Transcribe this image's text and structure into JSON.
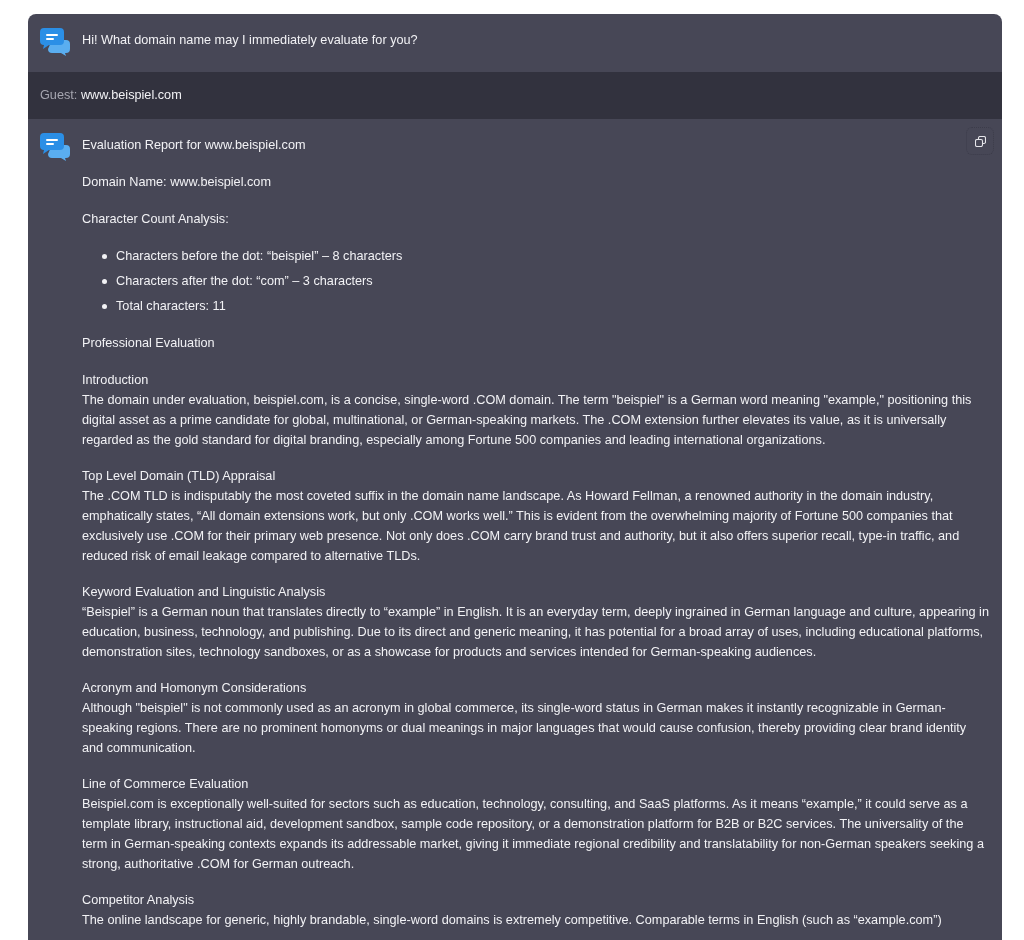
{
  "messages": [
    {
      "kind": "bot",
      "blocks": [
        {
          "kind": "paragraph",
          "text": "Hi! What domain name may I immediately evaluate for you?"
        }
      ]
    },
    {
      "kind": "guest",
      "label": "Guest:",
      "text": "www.beispiel.com"
    },
    {
      "kind": "bot",
      "copy_button": true,
      "blocks": [
        {
          "kind": "paragraph",
          "text": "Evaluation Report for www.beispiel.com"
        },
        {
          "kind": "paragraph",
          "text": "Domain Name: www.beispiel.com"
        },
        {
          "kind": "paragraph",
          "text": "Character Count Analysis:"
        },
        {
          "kind": "list",
          "items": [
            "Characters before the dot: “beispiel” – 8 characters",
            "Characters after the dot: “com” – 3 characters",
            "Total characters: 11"
          ]
        },
        {
          "kind": "paragraph",
          "text": "Professional Evaluation"
        },
        {
          "kind": "section",
          "heading": "Introduction",
          "text": "The domain under evaluation, beispiel.com, is a concise, single-word .COM domain. The term \"beispiel\" is a German word meaning \"example,\" positioning this digital asset as a prime candidate for global, multinational, or German-speaking markets. The .COM extension further elevates its value, as it is universally regarded as the gold standard for digital branding, especially among Fortune 500 companies and leading international organizations."
        },
        {
          "kind": "section",
          "heading": "Top Level Domain (TLD) Appraisal",
          "text": "The .COM TLD is indisputably the most coveted suffix in the domain name landscape. As Howard Fellman, a renowned authority in the domain industry, emphatically states, “All domain extensions work, but only .COM works well.” This is evident from the overwhelming majority of Fortune 500 companies that exclusively use .COM for their primary web presence. Not only does .COM carry brand trust and authority, but it also offers superior recall, type-in traffic, and reduced risk of email leakage compared to alternative TLDs."
        },
        {
          "kind": "section",
          "heading": "Keyword Evaluation and Linguistic Analysis",
          "text": "“Beispiel” is a German noun that translates directly to “example” in English. It is an everyday term, deeply ingrained in German language and culture, appearing in education, business, technology, and publishing. Due to its direct and generic meaning, it has potential for a broad array of uses, including educational platforms, demonstration sites, technology sandboxes, or as a showcase for products and services intended for German-speaking audiences."
        },
        {
          "kind": "section",
          "heading": "Acronym and Homonym Considerations",
          "text": "Although \"beispiel\" is not commonly used as an acronym in global commerce, its single-word status in German makes it instantly recognizable in German-speaking regions. There are no prominent homonyms or dual meanings in major languages that would cause confusion, thereby providing clear brand identity and communication."
        },
        {
          "kind": "section",
          "heading": "Line of Commerce Evaluation",
          "text": "Beispiel.com is exceptionally well-suited for sectors such as education, technology, consulting, and SaaS platforms. As it means “example,” it could serve as a template library, instructional aid, development sandbox, sample code repository, or a demonstration platform for B2B or B2C services. The universality of the term in German-speaking contexts expands its addressable market, giving it immediate regional credibility and translatability for non-German speakers seeking a strong, authoritative .COM for German outreach."
        },
        {
          "kind": "section",
          "heading": "Competitor Analysis",
          "text": "The online landscape for generic, highly brandable, single-word domains is extremely competitive. Comparable terms in English (such as “example.com”)"
        }
      ]
    }
  ]
}
